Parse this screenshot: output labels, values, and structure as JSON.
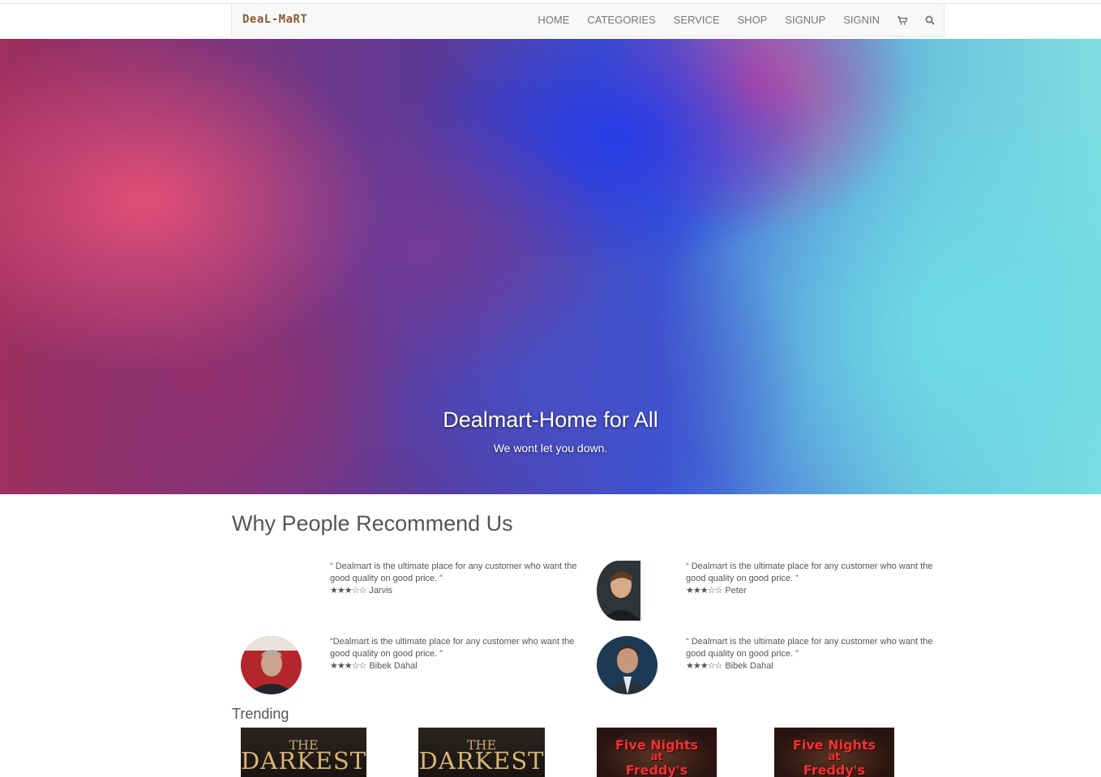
{
  "nav": {
    "brand": "DeaL-MaRT",
    "items": [
      "HOME",
      "CATEGORIES",
      "SERVICE",
      "SHOP",
      "SIGNUP",
      "SIGNIN"
    ],
    "icons": [
      "cart-icon",
      "search-icon"
    ]
  },
  "hero": {
    "title": "Dealmart-Home for All",
    "subtitle": "We wont let you down."
  },
  "recommend": {
    "title": "Why People Recommend Us",
    "testimonials": [
      {
        "quote": "“ Dealmart is the ultimate place for any customer who want the good quality on good price. ”",
        "stars": "★★★☆☆",
        "rating": 3,
        "name": "Jarvis",
        "avatar": "none"
      },
      {
        "quote": "“ Dealmart is the ultimate place for any customer who want the good quality on good price. ”",
        "stars": "★★★☆☆",
        "rating": 3,
        "name": "Peter",
        "avatar": "young-man-photo"
      },
      {
        "quote": "“Dealmart is the ultimate place for any customer who want the good quality on good price. ”",
        "stars": "★★★☆☆",
        "rating": 3,
        "name": "Bibek Dahal",
        "avatar": "man-red-seat-photo"
      },
      {
        "quote": "“ Dealmart is the ultimate place for any customer who want the good quality on good price. ”",
        "stars": "★★★☆☆",
        "rating": 3,
        "name": "Bibek Dahal",
        "avatar": "man-suit-photo"
      }
    ]
  },
  "trending": {
    "title": "Trending",
    "products": [
      {
        "cover_line1": "THE",
        "cover_line2": "DARKEST"
      },
      {
        "cover_line1": "THE",
        "cover_line2": "DARKEST"
      },
      {
        "cover_line1": "Five Nights",
        "cover_line2": "at",
        "cover_line3": "Freddy's"
      },
      {
        "cover_line1": "Five Nights",
        "cover_line2": "at",
        "cover_line3": "Freddy's"
      }
    ]
  }
}
